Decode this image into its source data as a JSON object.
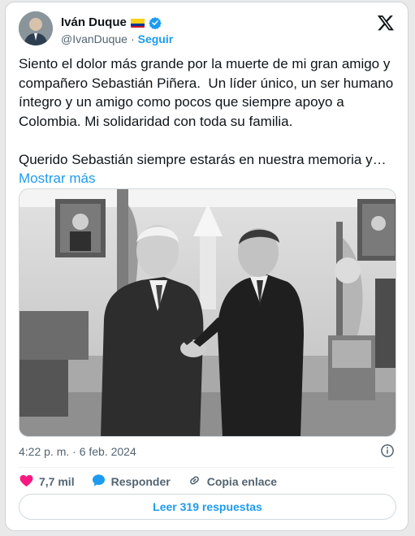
{
  "author": {
    "name": "Iván Duque",
    "handle": "@IvanDuque",
    "separator": "·",
    "follow_label": "Seguir"
  },
  "tweet": {
    "text": "Siento el dolor más grande por la muerte de mi gran amigo y compañero Sebastián Piñera.  Un líder único, un ser humano íntegro y un amigo como pocos que siempre apoyo a Colombia. Mi solidaridad con toda su familia.\n\nQuerido Sebastián siempre estarás en nuestra memoria y… ",
    "show_more": "Mostrar más"
  },
  "timestamp": "4:22 p. m. · 6 feb. 2024",
  "actions": {
    "likes": "7,7 mil",
    "reply": "Responder",
    "copy_link": "Copia enlace"
  },
  "read_replies": "Leer 319 respuestas",
  "icons": {
    "logo": "x-logo-icon",
    "verified": "verified-badge-icon",
    "flag": "colombia-flag-icon",
    "like": "heart-icon",
    "reply": "speech-bubble-icon",
    "link": "link-icon",
    "info": "info-icon"
  },
  "colors": {
    "accent": "#1d9bf0",
    "like": "#f91880",
    "muted": "#536471",
    "text": "#0f1419"
  }
}
